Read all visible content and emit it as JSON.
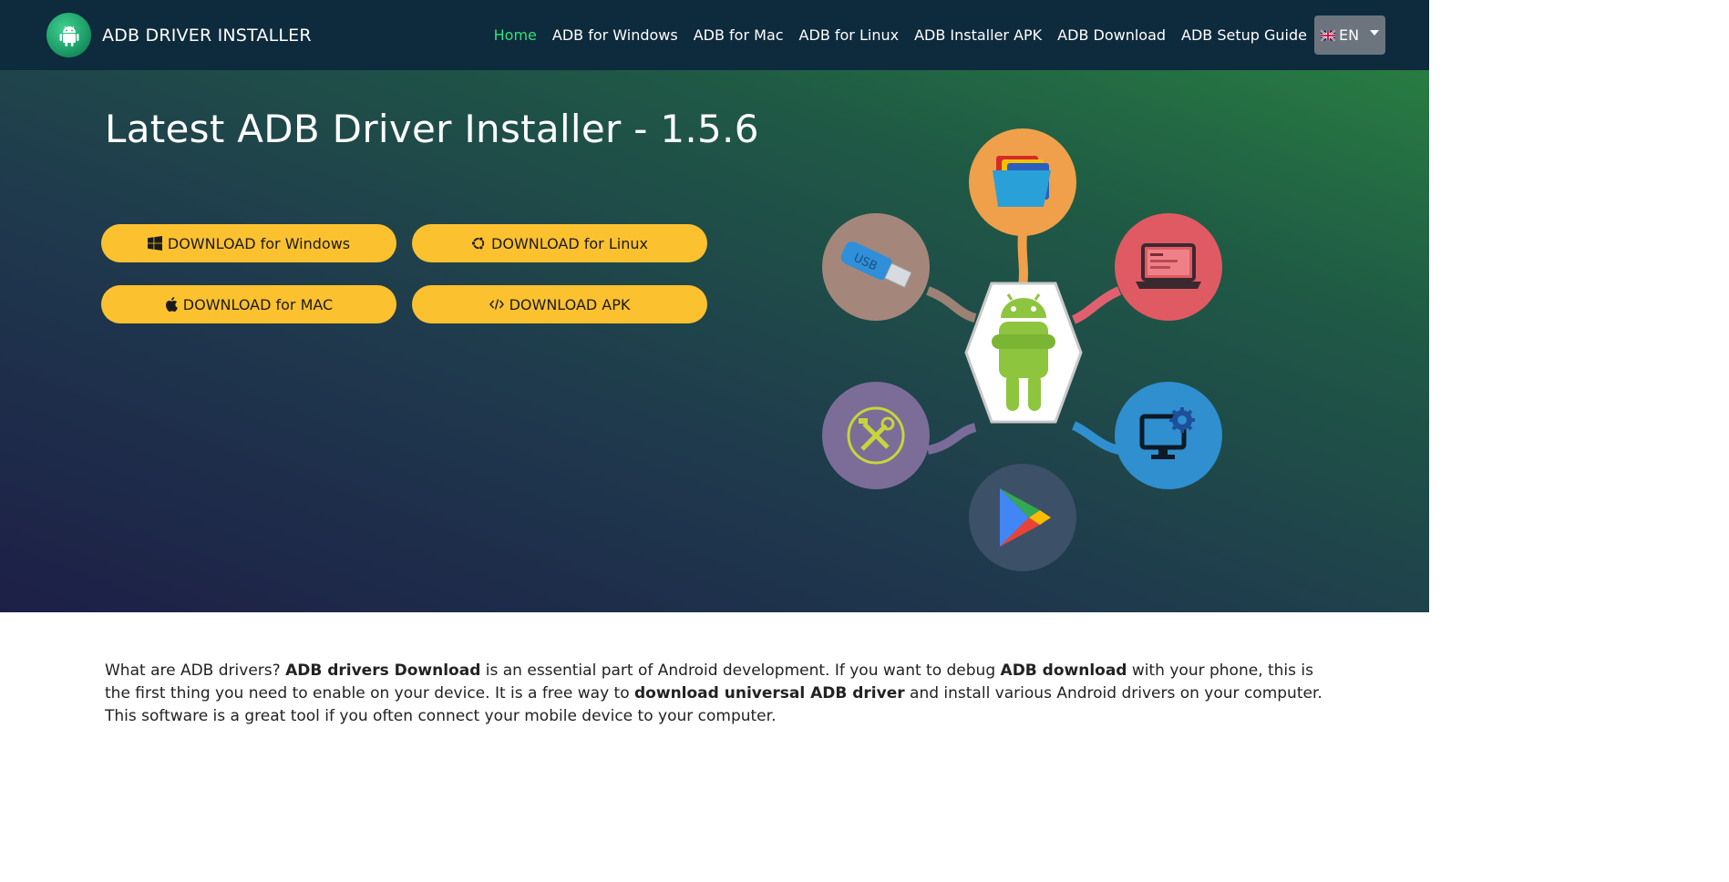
{
  "brand": {
    "name": "ADB DRIVER INSTALLER",
    "logo_icon": "android-icon"
  },
  "nav": {
    "items": [
      {
        "label": "Home",
        "active": true
      },
      {
        "label": "ADB for Windows",
        "active": false
      },
      {
        "label": "ADB for Mac",
        "active": false
      },
      {
        "label": "ADB for Linux",
        "active": false
      },
      {
        "label": "ADB Installer APK",
        "active": false
      },
      {
        "label": "ADB Download",
        "active": false
      },
      {
        "label": "ADB Setup Guide",
        "active": false
      }
    ],
    "language": {
      "label": "EN",
      "flag_icon": "uk-flag-icon"
    }
  },
  "hero": {
    "title": "Latest ADB Driver Installer - 1.5.6",
    "buttons": {
      "windows": {
        "label": "DOWNLOAD for Windows",
        "icon": "windows-icon"
      },
      "linux": {
        "label": "DOWNLOAD for Linux",
        "icon": "ubuntu-icon"
      },
      "mac": {
        "label": "DOWNLOAD for MAC",
        "icon": "apple-icon"
      },
      "apk": {
        "label": "DOWNLOAD APK",
        "icon": "code-icon"
      }
    }
  },
  "content": {
    "p1": "What are ADB drivers? ",
    "b1": "ADB drivers Download",
    "p2": " is an essential part of Android development. If you want to debug ",
    "b2": "ADB download",
    "p3": " with your phone, this is the first thing you need to enable on your device. It is a free way to ",
    "b3": "download universal ADB driver",
    "p4": " and install various Android drivers on your computer. This software is a great tool if you often connect your mobile device to your computer."
  },
  "colors": {
    "navbar": "#0e2a3d",
    "active_link": "#35e07a",
    "button_yellow": "#fcc12e",
    "lang_button": "#6c757d"
  }
}
